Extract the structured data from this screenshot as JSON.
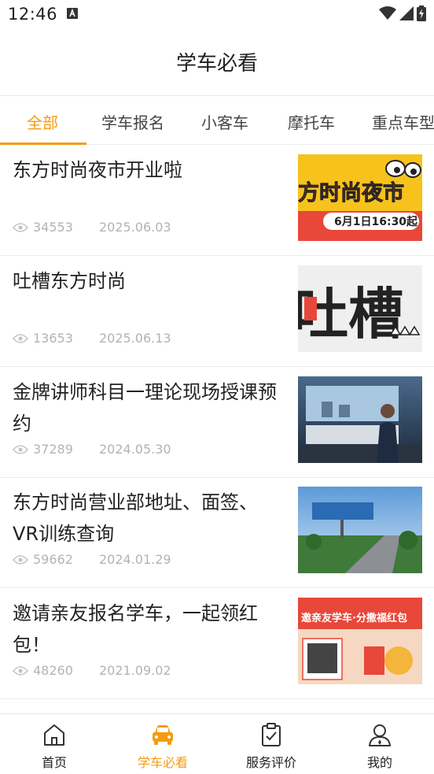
{
  "status_bar": {
    "time": "12:46"
  },
  "header": {
    "title": "学车必看"
  },
  "tabs": [
    {
      "label": "全部",
      "active": true
    },
    {
      "label": "学车报名",
      "active": false
    },
    {
      "label": "小客车",
      "active": false
    },
    {
      "label": "摩托车",
      "active": false
    },
    {
      "label": "重点车型",
      "active": false
    }
  ],
  "articles": [
    {
      "title": "东方时尚夜市开业啦",
      "views": "34553",
      "date": "2025.06.03",
      "thumb_text": "方时尚夜市",
      "thumb_sub": "6月1日16:30起"
    },
    {
      "title": "吐槽东方时尚",
      "views": "13653",
      "date": "2025.06.13",
      "thumb_text": "吐槽"
    },
    {
      "title": "金牌讲师科目一理论现场授课预约",
      "views": "37289",
      "date": "2024.05.30"
    },
    {
      "title": "东方时尚营业部地址、面签、VR训练查询",
      "views": "59662",
      "date": "2024.01.29"
    },
    {
      "title": "邀请亲友报名学车，一起领红包！",
      "views": "48260",
      "date": "2021.09.02",
      "thumb_text": "邀亲友学车·分撒福红包"
    }
  ],
  "bottom_nav": [
    {
      "label": "首页",
      "icon": "home-icon",
      "active": false
    },
    {
      "label": "学车必看",
      "icon": "car-icon",
      "active": true
    },
    {
      "label": "服务评价",
      "icon": "clipboard-check-icon",
      "active": false
    },
    {
      "label": "我的",
      "icon": "user-icon",
      "active": false
    }
  ],
  "colors": {
    "accent": "#f39c12",
    "text": "#222222",
    "meta": "#b3b3b3"
  }
}
